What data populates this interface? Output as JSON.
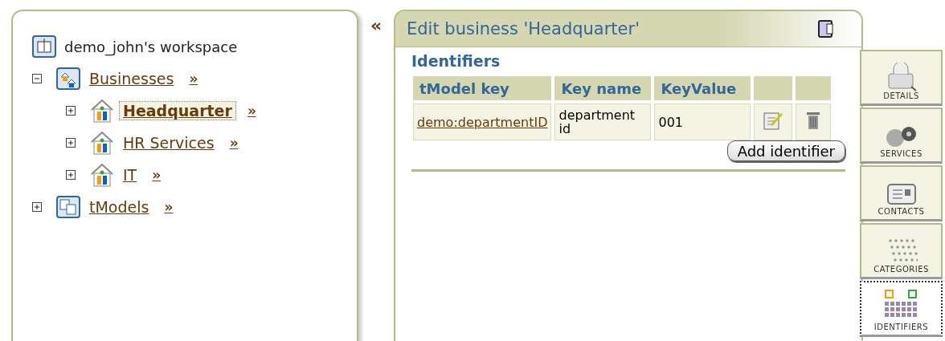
{
  "workspace": {
    "title": "demo_john's workspace"
  },
  "tree": [
    {
      "label": "Businesses",
      "kind": "folder",
      "expanded": true,
      "selected": false,
      "children": [
        {
          "label": "Headquarter",
          "kind": "business",
          "expanded": false,
          "selected": true
        },
        {
          "label": "HR Services",
          "kind": "business",
          "expanded": false,
          "selected": false
        },
        {
          "label": "IT",
          "kind": "business",
          "expanded": false,
          "selected": false
        }
      ]
    },
    {
      "label": "tModels",
      "kind": "tmodels",
      "expanded": false,
      "selected": false
    }
  ],
  "more_link": "»",
  "collapse": "«",
  "editor": {
    "title": "Edit business 'Headquarter'",
    "section": "Identifiers",
    "table": {
      "columns": [
        "tModel key",
        "Key name",
        "KeyValue"
      ],
      "rows": [
        {
          "tmodel_key": "demo:departmentID",
          "key_name": "department id",
          "key_value": "001"
        }
      ]
    },
    "add_button": "Add identifier"
  },
  "tabs": [
    {
      "label": "DETAILS",
      "kind": "details",
      "selected": false
    },
    {
      "label": "SERVICES",
      "kind": "services",
      "selected": false
    },
    {
      "label": "CONTACTS",
      "kind": "contacts",
      "selected": false
    },
    {
      "label": "CATEGORIES",
      "kind": "categories",
      "selected": false
    },
    {
      "label": "IDENTIFIERS",
      "kind": "identifiers",
      "selected": true
    }
  ]
}
